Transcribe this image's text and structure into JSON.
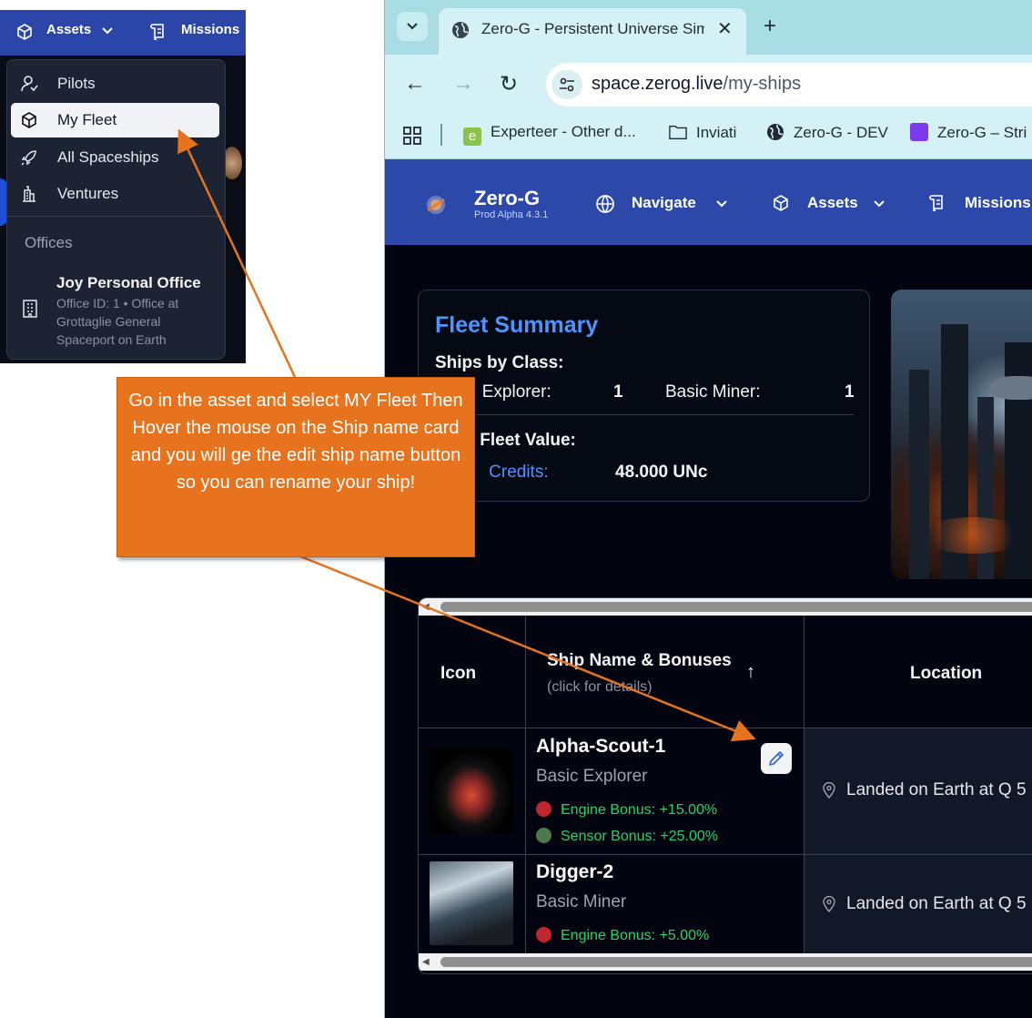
{
  "inset": {
    "nav": {
      "assets_label": "Assets",
      "missions_label": "Missions"
    },
    "menu": {
      "items": [
        {
          "label": "Pilots",
          "icon": "user-icon"
        },
        {
          "label": "My Fleet",
          "icon": "box-icon"
        },
        {
          "label": "All Spaceships",
          "icon": "rocket-icon"
        },
        {
          "label": "Ventures",
          "icon": "building-icon"
        }
      ],
      "offices_heading": "Offices",
      "office": {
        "title": "Joy Personal Office",
        "description": "Office ID: 1 • Office at Grottaglie General Spaceport on Earth",
        "icon": "office-building-icon"
      }
    }
  },
  "browser": {
    "tab_title": "Zero-G - Persistent Universe Sim",
    "url_host": "space.zerog.live",
    "url_path": "/my-ships",
    "bookmarks": [
      {
        "label": "Experteer - Other d...",
        "color": "#8bc34a"
      },
      {
        "label": "Inviati",
        "color": ""
      },
      {
        "label": "Zero-G - DEV",
        "color": "#1f2937"
      },
      {
        "label": "Zero-G – Stri",
        "color": "#7c3aed"
      }
    ]
  },
  "app": {
    "title": "Zero-G",
    "version": "Prod Alpha 4.3.1",
    "nav": {
      "navigate": "Navigate",
      "assets": "Assets",
      "missions": "Missions"
    },
    "accent": "#2c48a8"
  },
  "fleet_summary": {
    "title": "Fleet Summary",
    "ships_by_class_label": "Ships by Class:",
    "explorer_label": "Explorer:",
    "explorer_count": "1",
    "miner_label": "Basic Miner:",
    "miner_count": "1",
    "fleet_value_label": "Fleet Value:",
    "credits_label": "Credits:",
    "credits_value": "48.000 UNc"
  },
  "table": {
    "headers": {
      "icon": "Icon",
      "name": "Ship Name & Bonuses",
      "name_sub": "(click for details)",
      "location": "Location"
    },
    "rows": [
      {
        "name": "Alpha-Scout-1",
        "class": "Basic Explorer",
        "bonuses": [
          {
            "text": "Engine Bonus: +15.00%",
            "icon": "engine-icon"
          },
          {
            "text": "Sensor Bonus: +25.00%",
            "icon": "sensor-icon"
          }
        ],
        "location": "Landed on Earth at Q 5"
      },
      {
        "name": "Digger-2",
        "class": "Basic Miner",
        "bonuses": [
          {
            "text": "Engine Bonus: +5.00%",
            "icon": "engine-icon"
          }
        ],
        "location": "Landed on Earth at Q 5"
      }
    ]
  },
  "callout": {
    "text": "Go in the asset and select MY Fleet Then Hover the mouse on the Ship name card and you will ge the edit ship name button so you can rename your ship!",
    "color": "#e8731e"
  }
}
